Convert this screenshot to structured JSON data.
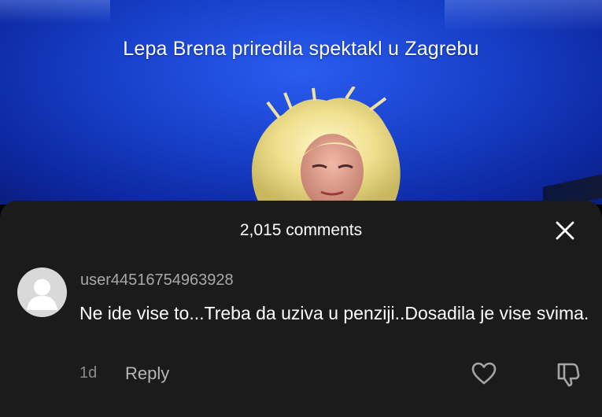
{
  "video": {
    "caption": "Lepa Brena priredila spektakl u Zagrebu",
    "background_color": "#1740c9"
  },
  "comments_sheet": {
    "title": "2,015 comments",
    "close_icon": "close-icon",
    "background_color": "#1b1b1b",
    "comment": {
      "username": "user44516754963928",
      "text": "Ne ide vise to...Treba da uziva u penziji..Dosadila je vise svima.",
      "age": "1d",
      "reply_label": "Reply",
      "avatar_icon": "default-avatar-icon",
      "like_icon": "heart-icon",
      "dislike_icon": "thumbs-down-icon"
    }
  }
}
